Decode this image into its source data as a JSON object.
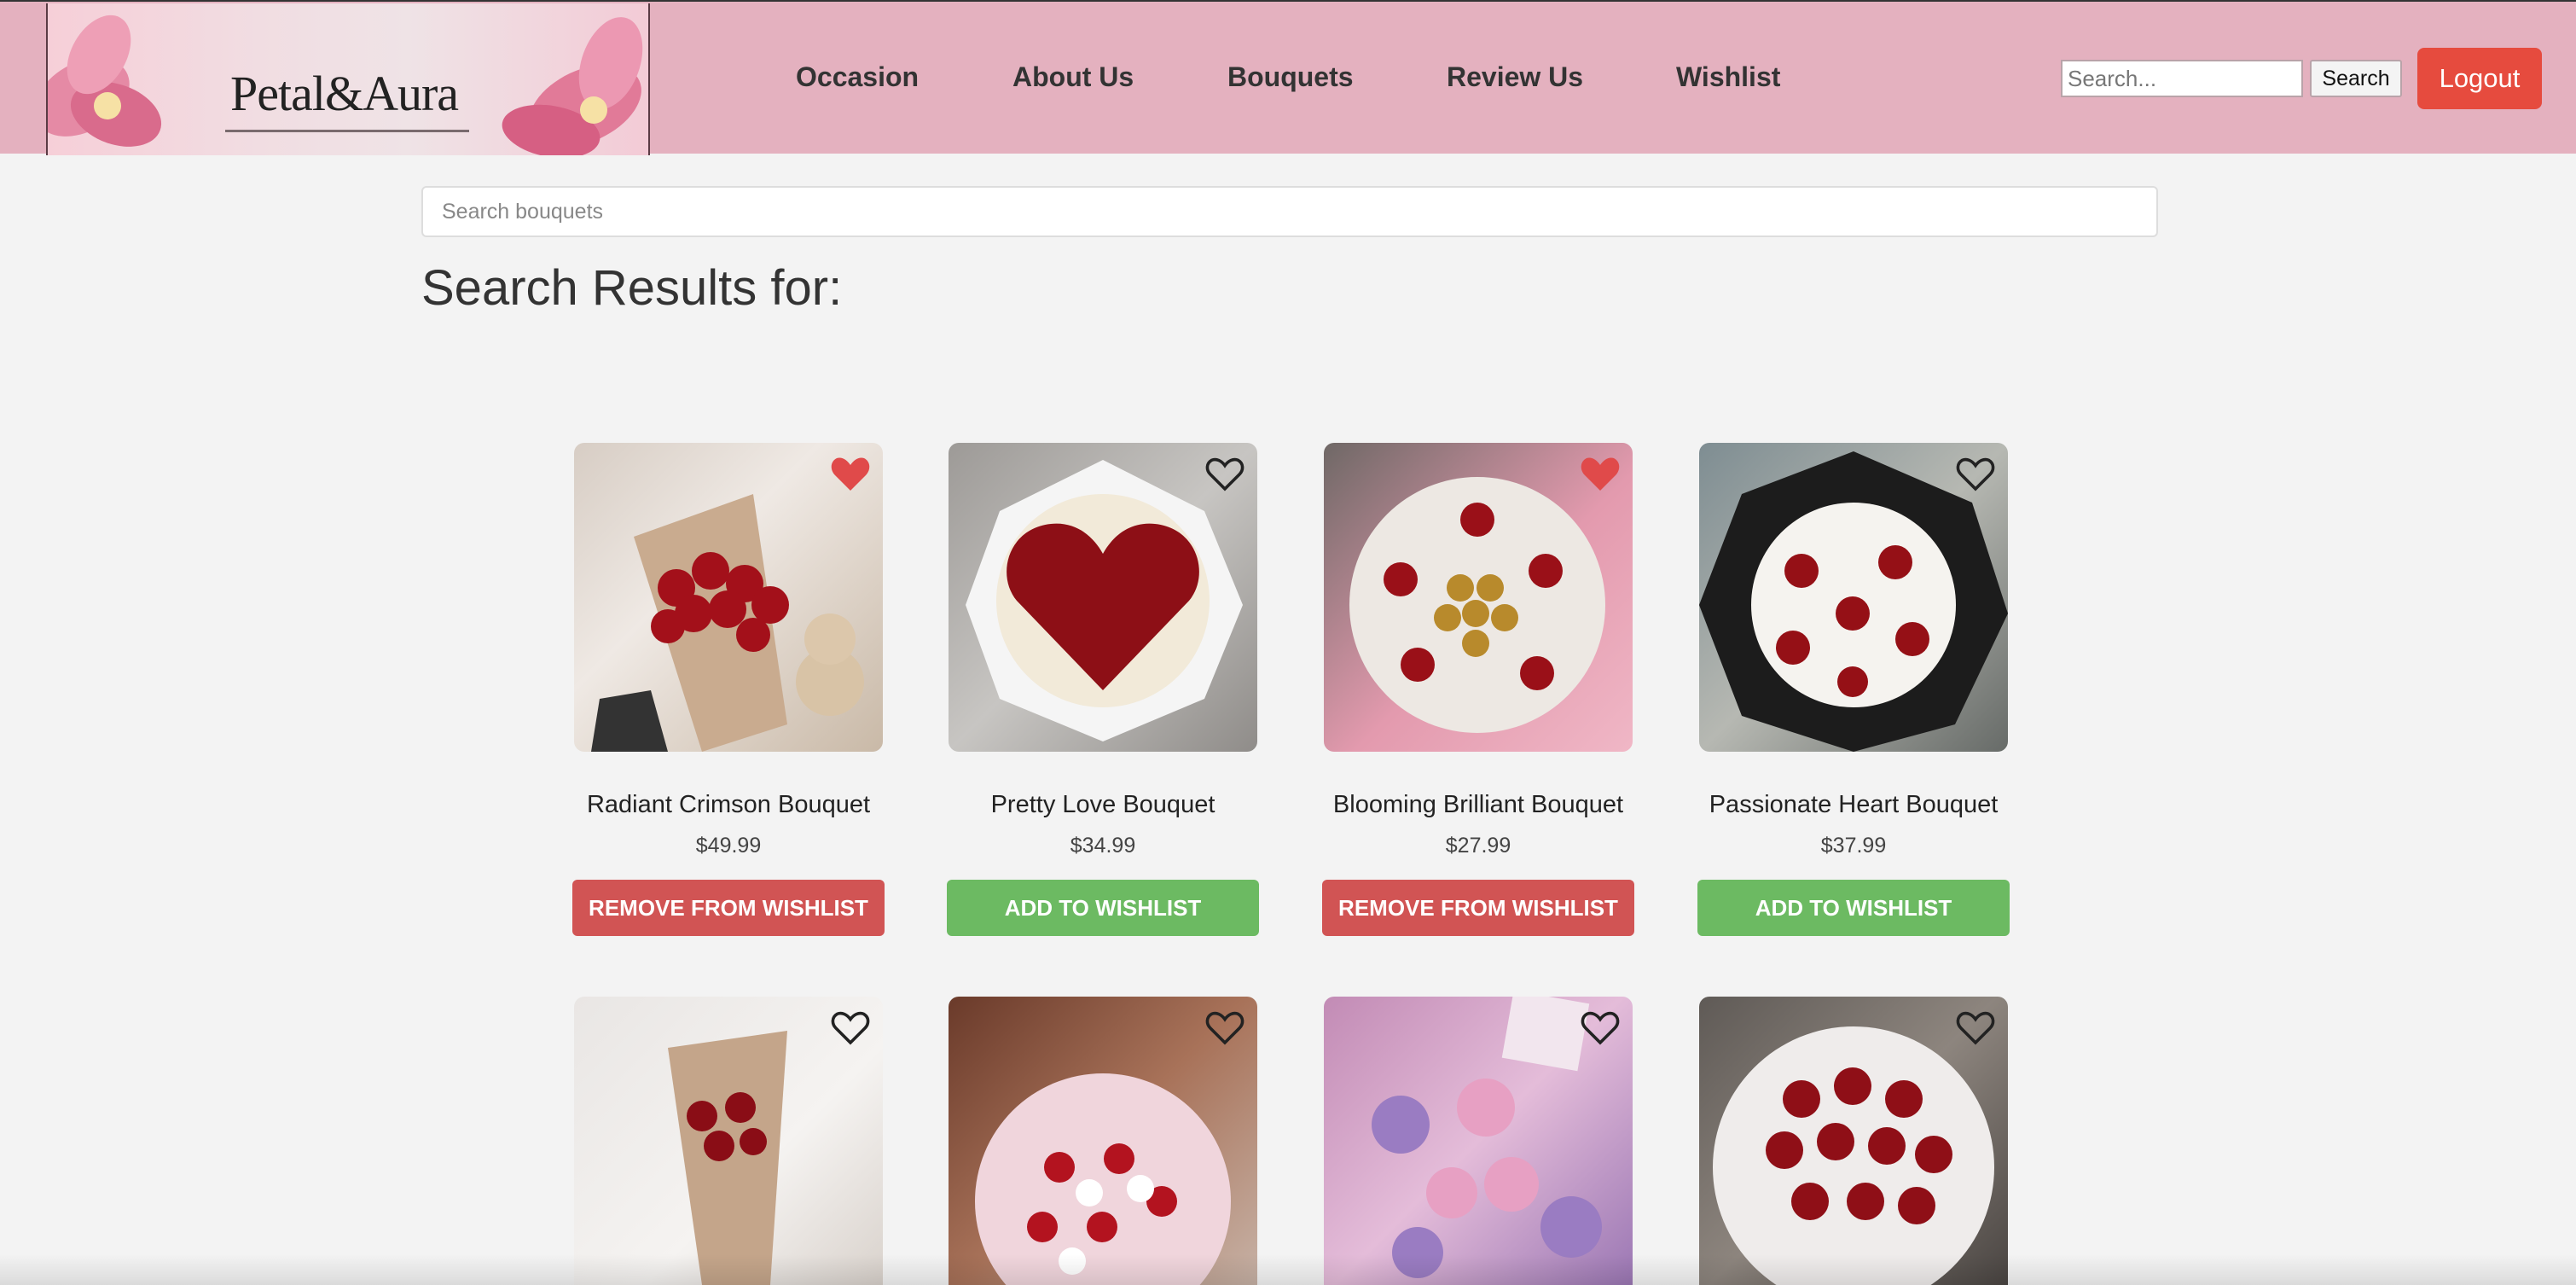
{
  "header": {
    "logo_text": "Petal&Aura",
    "nav": [
      "Occasion",
      "About Us",
      "Bouquets",
      "Review Us",
      "Wishlist"
    ],
    "search_placeholder": "Search...",
    "search_button": "Search",
    "logout_button": "Logout"
  },
  "main": {
    "search_placeholder": "Search bouquets",
    "results_title": "Search Results for:"
  },
  "products": [
    {
      "name": "Radiant Crimson Bouquet",
      "price": "$49.99",
      "button": "REMOVE FROM WISHLIST",
      "wishlisted": true,
      "heart_icon": "heart-filled-icon"
    },
    {
      "name": "Pretty Love Bouquet",
      "price": "$34.99",
      "button": "ADD TO WISHLIST",
      "wishlisted": false,
      "heart_icon": "heart-outline-icon"
    },
    {
      "name": "Blooming Brilliant Bouquet",
      "price": "$27.99",
      "button": "REMOVE FROM WISHLIST",
      "wishlisted": true,
      "heart_icon": "heart-filled-icon"
    },
    {
      "name": "Passionate Heart Bouquet",
      "price": "$37.99",
      "button": "ADD TO WISHLIST",
      "wishlisted": false,
      "heart_icon": "heart-outline-icon"
    }
  ],
  "second_row_hearts": [
    "heart-outline-icon",
    "heart-outline-icon",
    "heart-outline-icon",
    "heart-outline-icon"
  ],
  "colors": {
    "header_bg": "#e4b1bf",
    "logout_bg": "#e64b3e",
    "remove_bg": "#d15454",
    "add_bg": "#6cba62",
    "heart_filled": "#e04a4a",
    "page_bg": "#f3f3f3"
  }
}
